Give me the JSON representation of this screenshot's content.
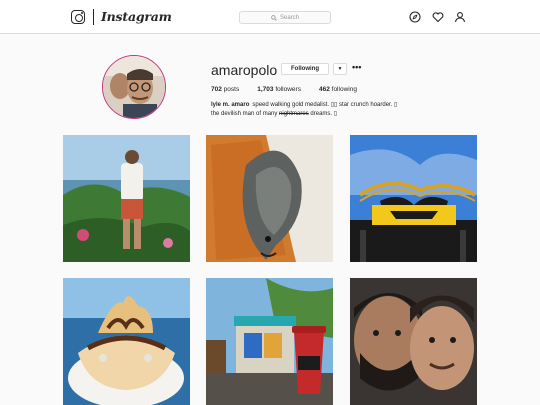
{
  "nav": {
    "brand": "Instagram",
    "search_placeholder": "Search"
  },
  "profile": {
    "username": "amaropolo",
    "follow_label": "Following",
    "more_label": "•••",
    "stats": {
      "posts": "702",
      "posts_label": "posts",
      "followers": "1,703",
      "followers_label": "followers",
      "following": "462",
      "following_label": "following"
    },
    "bio_name": "lyle m. amaro",
    "bio_line1": "speed walking gold medalist. ▯▯ star crunch hoarder. ▯",
    "bio_line2_pre": "the devilish man of many",
    "bio_line2_strike": "nightmares",
    "bio_line2_post": "dreams. ▯"
  },
  "posts": [
    {
      "subject": "man-standing-at-overlook"
    },
    {
      "subject": "fish-on-table"
    },
    {
      "subject": "batman-ride-sign"
    },
    {
      "subject": "ice-cream-sundae"
    },
    {
      "subject": "street-scene-with-cup"
    },
    {
      "subject": "two-men-selfie"
    }
  ]
}
